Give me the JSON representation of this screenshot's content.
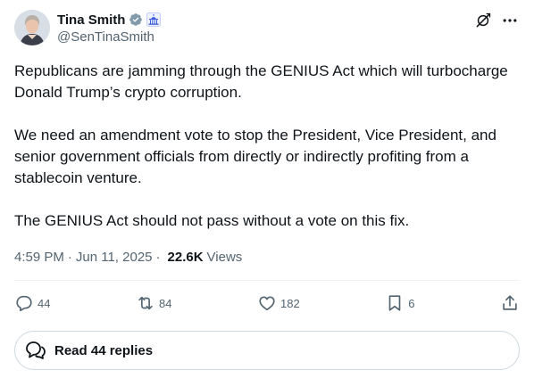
{
  "author": {
    "display_name": "Tina Smith",
    "handle": "@SenTinaSmith",
    "verified_badge_color": "#829aab",
    "affiliation_icon": "capitol-building-icon",
    "affiliation_color": "#3b5bdb"
  },
  "tweet": {
    "paragraphs": [
      "Republicans are jamming through the GENIUS Act which will turbocharge Donald Trump’s crypto corruption.",
      "We need an amendment vote to stop the President, Vice President, and senior government officials from directly or indirectly profiting from a stablecoin venture.",
      "The GENIUS Act should not pass without a vote on this fix."
    ],
    "time": "4:59 PM",
    "date": "Jun 11, 2025",
    "views_count": "22.6K",
    "views_label": "Views"
  },
  "actions": {
    "replies": "44",
    "reposts": "84",
    "likes": "182",
    "bookmarks": "6"
  },
  "read_replies_label": "Read 44 replies",
  "colors": {
    "text": "#0f1419",
    "muted": "#536471",
    "border": "#cfd9de",
    "divider": "#eff3f4"
  }
}
